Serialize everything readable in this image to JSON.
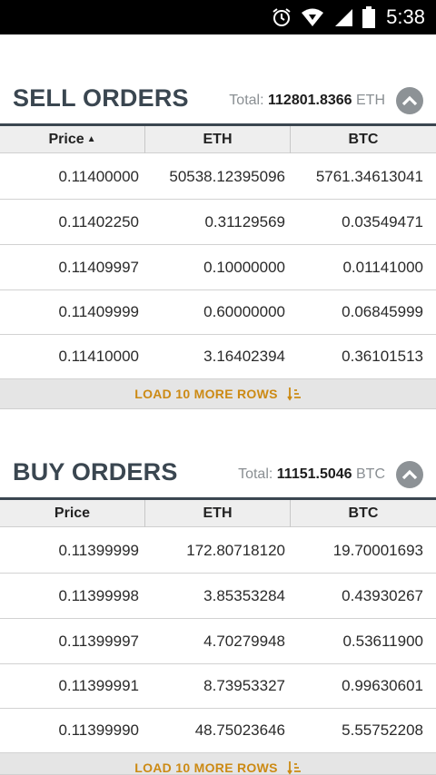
{
  "status_bar": {
    "time": "5:38",
    "icons": [
      "alarm-icon",
      "wifi-icon",
      "signal-icon",
      "battery-icon"
    ]
  },
  "sell": {
    "title": "SELL ORDERS",
    "total_label": "Total:",
    "total_value": "112801.8366",
    "total_unit": "ETH",
    "columns": [
      "Price",
      "ETH",
      "BTC"
    ],
    "rows": [
      [
        "0.11400000",
        "50538.12395096",
        "5761.34613041"
      ],
      [
        "0.11402250",
        "0.31129569",
        "0.03549471"
      ],
      [
        "0.11409997",
        "0.10000000",
        "0.01141000"
      ],
      [
        "0.11409999",
        "0.60000000",
        "0.06845999"
      ],
      [
        "0.11410000",
        "3.16402394",
        "0.36101513"
      ]
    ],
    "load_more": "LOAD 10 MORE ROWS"
  },
  "buy": {
    "title": "BUY ORDERS",
    "total_label": "Total:",
    "total_value": "11151.5046",
    "total_unit": "BTC",
    "columns": [
      "Price",
      "ETH",
      "BTC"
    ],
    "rows": [
      [
        "0.11399999",
        "172.80718120",
        "19.70001693"
      ],
      [
        "0.11399998",
        "3.85353284",
        "0.43930267"
      ],
      [
        "0.11399997",
        "4.70279948",
        "0.53611900"
      ],
      [
        "0.11399991",
        "8.73953327",
        "0.99630601"
      ],
      [
        "0.11399990",
        "48.75023646",
        "5.55752208"
      ]
    ],
    "load_more": "LOAD 10 MORE ROWS"
  },
  "colors": {
    "accent": "#cc8a14",
    "title": "#3a4650",
    "collapse_button": "#8d9296"
  }
}
